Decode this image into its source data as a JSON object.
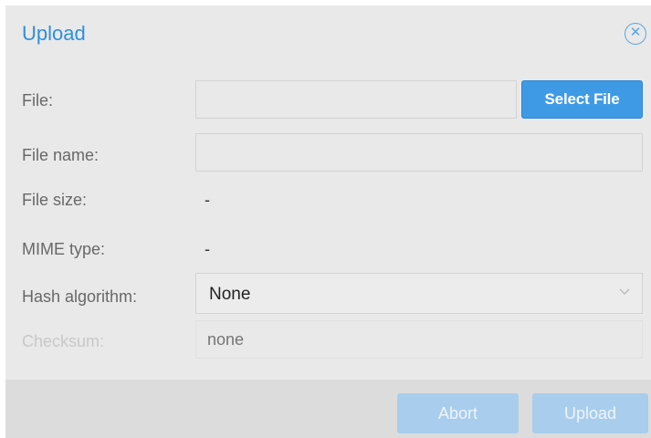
{
  "dialog": {
    "title": "Upload",
    "close_icon": "close-circle-icon"
  },
  "form": {
    "file": {
      "label": "File:",
      "value": "",
      "button_label": "Select File"
    },
    "file_name": {
      "label": "File name:",
      "value": ""
    },
    "file_size": {
      "label": "File size:",
      "value": "-"
    },
    "mime_type": {
      "label": "MIME type:",
      "value": "-"
    },
    "hash_algorithm": {
      "label": "Hash algorithm:",
      "selected": "None",
      "icon": "chevron-down-icon"
    },
    "checksum": {
      "label": "Checksum:",
      "placeholder": "none"
    }
  },
  "footer": {
    "abort_label": "Abort",
    "upload_label": "Upload"
  },
  "colors": {
    "accent": "#3f9ae6",
    "title": "#2f8fdd",
    "disabled_button": "#a9cdec",
    "background": "#e9e9e9"
  }
}
